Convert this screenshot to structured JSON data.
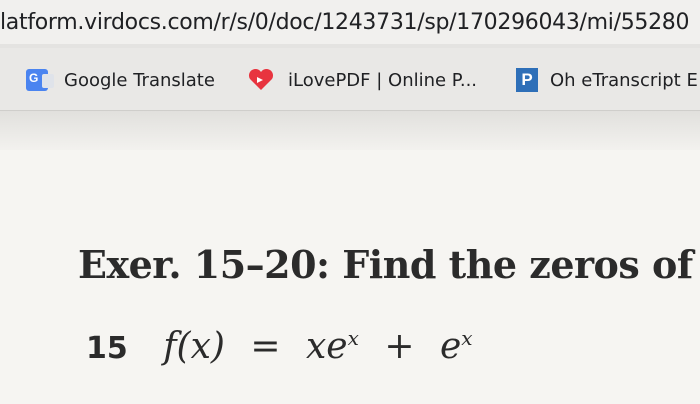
{
  "browser": {
    "url": "latform.virdocs.com/r/s/0/doc/1243731/sp/170296043/mi/55280",
    "bookmarks": [
      {
        "label": "Google Translate",
        "icon": "google-translate-icon",
        "icon_text": "G"
      },
      {
        "label": "iLovePDF | Online P...",
        "icon": "heart-icon",
        "color": "#e8343f"
      },
      {
        "label": "Oh eTranscript E",
        "icon": "p-icon",
        "icon_text": "P",
        "color": "#2e6fb8"
      }
    ]
  },
  "document": {
    "heading": "Exer. 15–20: Find the zeros of",
    "problem_number": "15",
    "equation": {
      "lhs": "f(x)",
      "equals": "=",
      "term1": "xe",
      "exp1": "x",
      "plus": "+",
      "term2": "e",
      "exp2": "x"
    }
  }
}
